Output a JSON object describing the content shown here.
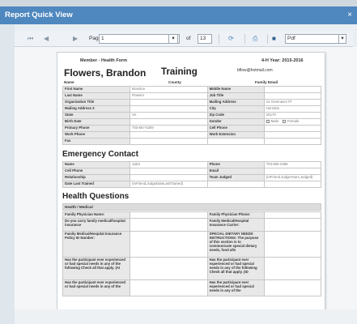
{
  "dialog": {
    "title": "Report Quick View",
    "close": "×"
  },
  "toolbar": {
    "page_label": "Page",
    "page_value": "1",
    "of_label": "of",
    "total_pages": "13",
    "format_value": "Pdf"
  },
  "report": {
    "form_title": "Member - Health Form",
    "year_label": "4-H Year: 2015-2016",
    "member_name": "Flowers, Brandon",
    "training": "Training",
    "email": "bflow@hotmail.com",
    "name_header": "Name",
    "county_header": "County",
    "family_email_header": "Family Email",
    "rows": [
      [
        "First Name",
        "Brandon",
        "Middle Name",
        ""
      ],
      [
        "Last Name",
        "Flowers",
        "Job Title",
        ""
      ],
      [
        "Organization Title",
        "",
        "Mailing Address",
        "12 Greenacre Pl"
      ],
      [
        "Mailing Address 2",
        "",
        "City",
        "Herndon"
      ],
      [
        "State",
        "VA",
        "Zip Code",
        "20170"
      ],
      [
        "Birth Date",
        "",
        "Gender",
        ""
      ],
      [
        "Primary Phone",
        "703-867-5309",
        "Cell Phone",
        ""
      ],
      [
        "Work Phone",
        "",
        "Work Extension",
        ""
      ],
      [
        "Fax",
        "",
        "",
        ""
      ]
    ],
    "gender_male": "Male",
    "gender_female": "Female",
    "emergency_title": "Emergency Contact",
    "emergency_rows": [
      [
        "Name",
        "Juliet",
        "Phone",
        "703-555-2368"
      ],
      [
        "Cell Phone",
        "",
        "Email",
        ""
      ],
      [
        "Relationship",
        "",
        "Team Judged",
        "(mFriend.JudgeYears.Judged)"
      ],
      [
        "Date Last Trained",
        "(mFriend.JudgeDateLastTrained)",
        "",
        ""
      ]
    ],
    "health_title": "Health Questions",
    "health_sub": "Health / Medical",
    "health_rows": [
      [
        "Family Physician Name:",
        "",
        "Family Physician Phone:",
        ""
      ],
      [
        "Do you carry family medical/hospital insurance",
        "",
        "Family Medical/Hospital Insurance Carrier:",
        ""
      ],
      [
        "Family Medical/Hospital Insurance Policy ID Number:",
        "",
        "SPECIAL DIETARY NEEDS INSTRUCTIONS: The purpose of this section is to communicate special dietary needs, food alle",
        ""
      ],
      [
        "Has the participant ever experienced or had special needs in any of the following Check all that apply. (AI",
        "",
        "Has the participant ever experienced or had special needs in any of the following Check all that apply. (ID",
        ""
      ],
      [
        "Has the participant ever experienced or had special needs in any of the",
        "",
        "Has the participant ever experienced or had special needs in any of the",
        ""
      ]
    ]
  }
}
